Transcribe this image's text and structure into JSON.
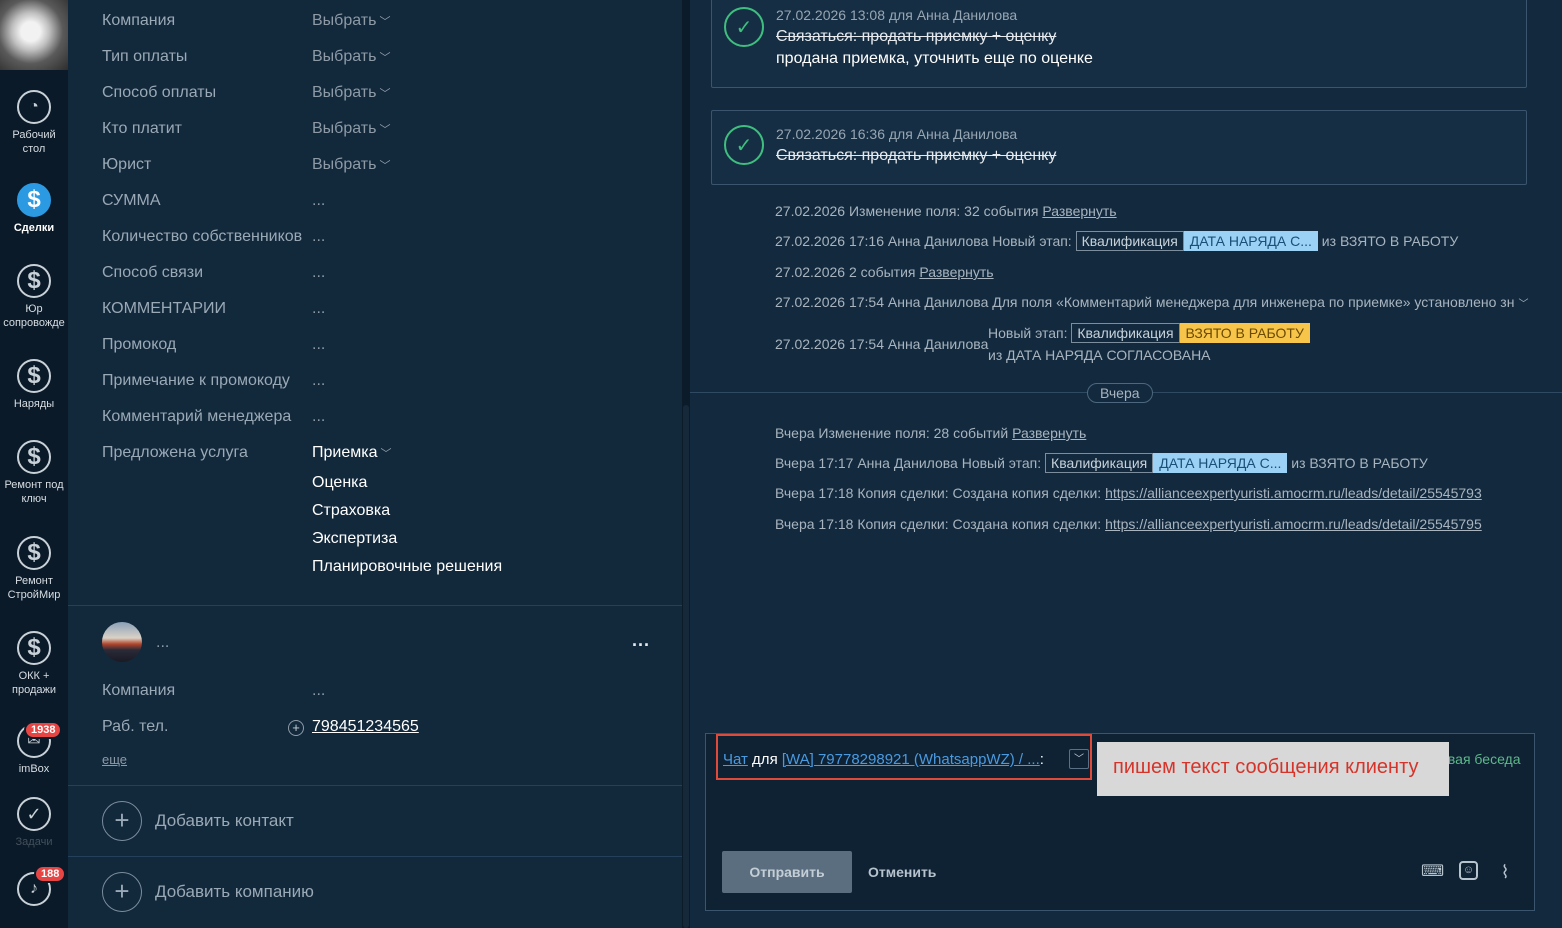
{
  "nav": {
    "items": [
      {
        "label": "Рабочий стол",
        "icon": "dashboard-icon"
      },
      {
        "label": "Сделки",
        "icon": "dollar-icon",
        "active": true
      },
      {
        "label": "Юр сопровожде",
        "icon": "dollar-icon"
      },
      {
        "label": "Наряды",
        "icon": "dollar-icon"
      },
      {
        "label": "Ремонт под ключ",
        "icon": "dollar-icon"
      },
      {
        "label": "Ремонт СтройМир",
        "icon": "dollar-icon"
      },
      {
        "label": "ОКК + продажи",
        "icon": "dollar-icon"
      },
      {
        "label": "imBox",
        "icon": "chat-icon",
        "badge": "1938"
      },
      {
        "label": "Задачи",
        "icon": "check-icon"
      },
      {
        "label": "",
        "icon": "bell-icon",
        "badge": "188"
      }
    ]
  },
  "fields": [
    {
      "label": "Компания",
      "value": "Выбрать",
      "dropdown": true
    },
    {
      "label": "Тип оплаты",
      "value": "Выбрать",
      "dropdown": true
    },
    {
      "label": "Способ оплаты",
      "value": "Выбрать",
      "dropdown": true
    },
    {
      "label": "Кто платит",
      "value": "Выбрать",
      "dropdown": true
    },
    {
      "label": "Юрист",
      "value": "Выбрать",
      "dropdown": true
    },
    {
      "label": "СУММА",
      "value": "..."
    },
    {
      "label": "Количество собственников",
      "value": "..."
    },
    {
      "label": "Способ связи",
      "value": "..."
    },
    {
      "label": "КОММЕНТАРИИ",
      "value": "..."
    },
    {
      "label": "Промокод",
      "value": "..."
    },
    {
      "label": "Примечание к промокоду",
      "value": "..."
    },
    {
      "label": "Комментарий менеджера",
      "value": "..."
    },
    {
      "label": "Предложена услуга",
      "value": "Приемка",
      "dropdown": true
    }
  ],
  "services": [
    "Оценка",
    "Страховка",
    "Экспертиза",
    "Планировочные решения"
  ],
  "contact": {
    "name": "...",
    "more": "...",
    "company_label": "Компания",
    "company_value": "...",
    "phone_label": "Раб. тел.",
    "phone_value": "798451234565",
    "more_link": "еще",
    "add_contact": "Добавить контакт",
    "add_company": "Добавить компанию"
  },
  "tasks": [
    {
      "meta": "27.02.2026 13:08  для Анна Данилова",
      "title": "Связаться: продать приемку + оценку",
      "result": "продана приемка, уточнить еще по оценке"
    },
    {
      "meta": "27.02.2026 16:36  для Анна Данилова",
      "title": "Связаться: продать приемку + оценку"
    }
  ],
  "events": {
    "e1_text": "27.02.2026 Изменение поля: 32 события ",
    "e1_link": "Развернуть",
    "e2_text": "27.02.2026 17:16 Анна Данилова Новый этап: ",
    "e2_tag1": "Квалификация",
    "e2_tag2": "ДАТА НАРЯДА С...",
    "e2_tail": " из ВЗЯТО В РАБОТУ",
    "e3_text": "27.02.2026 2 события ",
    "e3_link": "Развернуть",
    "e4_text": "27.02.2026 17:54 Анна Данилова Для поля «Комментарий менеджера для инженера по приемке» установлено зн",
    "e5_text": "27.02.2026 17:54 Анна Данилова",
    "e5_stage": "Новый этап: ",
    "e5_tag1": "Квалификация",
    "e5_tag2": "ВЗЯТО В РАБОТУ",
    "e5_from": "из ДАТА НАРЯДА СОГЛАСОВАНА",
    "divider": "Вчера",
    "y1_text": "Вчера Изменение поля: 28 событий ",
    "y1_link": "Развернуть",
    "y2_text": "Вчера 17:17 Анна Данилова Новый этап: ",
    "y2_tag1": "Квалификация",
    "y2_tag2": "ДАТА НАРЯДА С...",
    "y2_tail": " из ВЗЯТО В РАБОТУ",
    "y3_text": "Вчера 17:18 Копия сделки: Создана копия сделки: ",
    "y3_link": "https://allianceexpertyuristi.amocrm.ru/leads/detail/25545793",
    "y4_text": "Вчера 17:18 Копия сделки: Создана копия сделки: ",
    "y4_link": "https://allianceexpertyuristi.amocrm.ru/leads/detail/25545795"
  },
  "composer": {
    "chat_link": "Чат",
    "for_text": " для ",
    "recipient": "[WA] 79778298921 (WhatsappWZ) / ...",
    "colon": ":",
    "hint": "пишем текст сообщения клиенту",
    "new_chat": "Новая беседа",
    "send": "Отправить",
    "cancel": "Отменить"
  }
}
